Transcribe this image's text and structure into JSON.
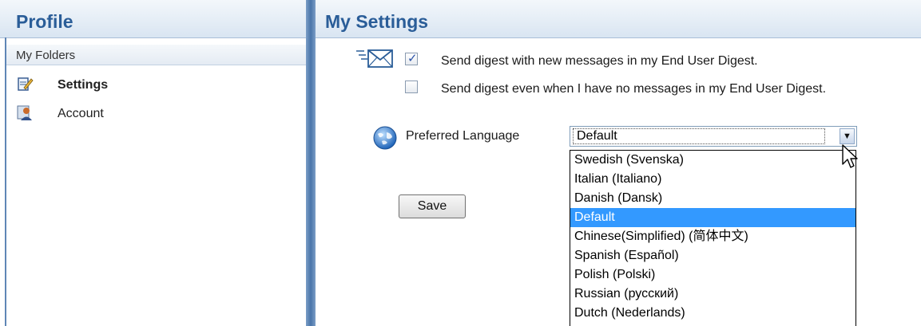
{
  "left": {
    "title": "Profile",
    "folders_label": "My Folders",
    "nav": [
      {
        "label": "Settings",
        "icon": "settings-icon",
        "active": true
      },
      {
        "label": "Account",
        "icon": "account-icon",
        "active": false
      }
    ]
  },
  "right": {
    "title": "My Settings",
    "options": [
      {
        "label": "Send digest with new messages in my End User Digest.",
        "checked": true
      },
      {
        "label": "Send digest even when I have no messages in my End User Digest.",
        "checked": false
      }
    ],
    "language": {
      "label": "Preferred Language",
      "selected": "Default",
      "options": [
        "Swedish (Svenska)",
        "Italian (Italiano)",
        "Danish (Dansk)",
        "Default",
        "Chinese(Simplified) (简体中文)",
        "Spanish (Español)",
        "Polish (Polski)",
        "Russian (русский)",
        "Dutch (Nederlands)"
      ]
    },
    "save_label": "Save"
  },
  "colors": {
    "accent": "#2a5d98",
    "highlight": "#3399ff",
    "divider": "#4a75a9"
  }
}
